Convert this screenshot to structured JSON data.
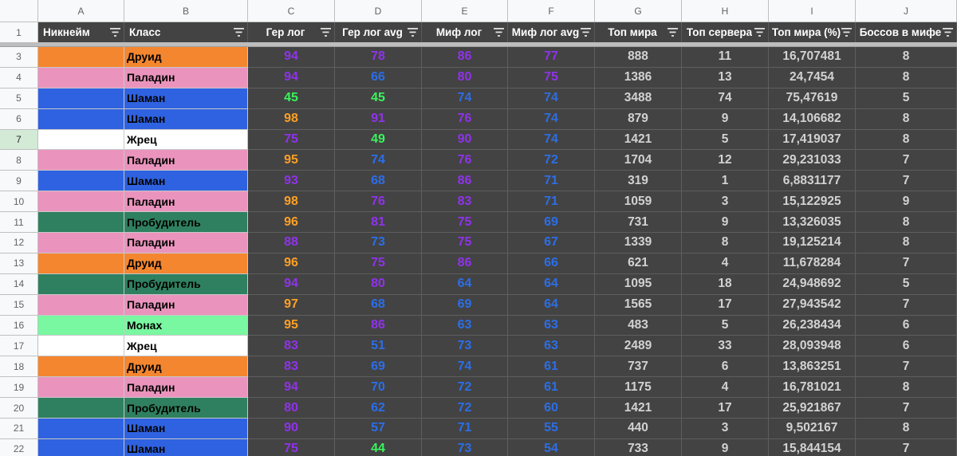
{
  "column_letters": [
    "A",
    "B",
    "C",
    "D",
    "E",
    "F",
    "G",
    "H",
    "I",
    "J"
  ],
  "headers": {
    "row_number": "1",
    "a": "Никнейм",
    "b": "Класс",
    "c": "Гер лог",
    "d": "Гер лог avg",
    "e": "Миф лог",
    "f": "Миф лог avg",
    "g": "Топ мира",
    "h": "Топ сервера",
    "i": "Топ мира (%)",
    "j": "Боссов в мифе"
  },
  "class_colors": {
    "Друид": "#f4862f",
    "Паладин": "#ea94bd",
    "Шаман": "#2f62e0",
    "Жрец": "#ffffff",
    "Пробудитель": "#2f8060",
    "Монах": "#79f7a1"
  },
  "value_colors": {
    "orange": "#ffa025",
    "purple": "#9032ec",
    "blue": "#2b6ee8",
    "green": "#39f45c"
  },
  "rows": [
    {
      "n": "3",
      "cls": "Друид",
      "c": "94",
      "cc": "purple",
      "d": "78",
      "dc": "purple",
      "e": "86",
      "ec": "purple",
      "f": "77",
      "fc": "purple",
      "g": "888",
      "h": "11",
      "i": "16,707481",
      "j": "8"
    },
    {
      "n": "4",
      "cls": "Паладин",
      "c": "94",
      "cc": "purple",
      "d": "66",
      "dc": "blue",
      "e": "80",
      "ec": "purple",
      "f": "75",
      "fc": "purple",
      "g": "1386",
      "h": "13",
      "i": "24,7454",
      "j": "8"
    },
    {
      "n": "5",
      "cls": "Шаман",
      "c": "45",
      "cc": "green",
      "d": "45",
      "dc": "green",
      "e": "74",
      "ec": "blue",
      "f": "74",
      "fc": "blue",
      "g": "3488",
      "h": "74",
      "i": "75,47619",
      "j": "5"
    },
    {
      "n": "6",
      "cls": "Шаман",
      "c": "98",
      "cc": "orange",
      "d": "91",
      "dc": "purple",
      "e": "76",
      "ec": "purple",
      "f": "74",
      "fc": "blue",
      "g": "879",
      "h": "9",
      "i": "14,106682",
      "j": "8"
    },
    {
      "n": "7",
      "cls": "Жрец",
      "c": "75",
      "cc": "purple",
      "d": "49",
      "dc": "green",
      "e": "90",
      "ec": "purple",
      "f": "74",
      "fc": "blue",
      "g": "1421",
      "h": "5",
      "i": "17,419037",
      "j": "8",
      "selected": true
    },
    {
      "n": "8",
      "cls": "Паладин",
      "c": "95",
      "cc": "orange",
      "d": "74",
      "dc": "blue",
      "e": "76",
      "ec": "purple",
      "f": "72",
      "fc": "blue",
      "g": "1704",
      "h": "12",
      "i": "29,231033",
      "j": "7"
    },
    {
      "n": "9",
      "cls": "Шаман",
      "c": "93",
      "cc": "purple",
      "d": "68",
      "dc": "blue",
      "e": "86",
      "ec": "purple",
      "f": "71",
      "fc": "blue",
      "g": "319",
      "h": "1",
      "i": "6,8831177",
      "j": "7"
    },
    {
      "n": "10",
      "cls": "Паладин",
      "c": "98",
      "cc": "orange",
      "d": "76",
      "dc": "purple",
      "e": "83",
      "ec": "purple",
      "f": "71",
      "fc": "blue",
      "g": "1059",
      "h": "3",
      "i": "15,122925",
      "j": "9"
    },
    {
      "n": "11",
      "cls": "Пробудитель",
      "c": "96",
      "cc": "orange",
      "d": "81",
      "dc": "purple",
      "e": "75",
      "ec": "purple",
      "f": "69",
      "fc": "blue",
      "g": "731",
      "h": "9",
      "i": "13,326035",
      "j": "8"
    },
    {
      "n": "12",
      "cls": "Паладин",
      "c": "88",
      "cc": "purple",
      "d": "73",
      "dc": "blue",
      "e": "75",
      "ec": "purple",
      "f": "67",
      "fc": "blue",
      "g": "1339",
      "h": "8",
      "i": "19,125214",
      "j": "8"
    },
    {
      "n": "13",
      "cls": "Друид",
      "c": "96",
      "cc": "orange",
      "d": "75",
      "dc": "purple",
      "e": "86",
      "ec": "purple",
      "f": "66",
      "fc": "blue",
      "g": "621",
      "h": "4",
      "i": "11,678284",
      "j": "7"
    },
    {
      "n": "14",
      "cls": "Пробудитель",
      "c": "94",
      "cc": "purple",
      "d": "80",
      "dc": "purple",
      "e": "64",
      "ec": "blue",
      "f": "64",
      "fc": "blue",
      "g": "1095",
      "h": "18",
      "i": "24,948692",
      "j": "5"
    },
    {
      "n": "15",
      "cls": "Паладин",
      "c": "97",
      "cc": "orange",
      "d": "68",
      "dc": "blue",
      "e": "69",
      "ec": "blue",
      "f": "64",
      "fc": "blue",
      "g": "1565",
      "h": "17",
      "i": "27,943542",
      "j": "7"
    },
    {
      "n": "16",
      "cls": "Монах",
      "c": "95",
      "cc": "orange",
      "d": "86",
      "dc": "purple",
      "e": "63",
      "ec": "blue",
      "f": "63",
      "fc": "blue",
      "g": "483",
      "h": "5",
      "i": "26,238434",
      "j": "6"
    },
    {
      "n": "17",
      "cls": "Жрец",
      "c": "83",
      "cc": "purple",
      "d": "51",
      "dc": "blue",
      "e": "73",
      "ec": "blue",
      "f": "63",
      "fc": "blue",
      "g": "2489",
      "h": "33",
      "i": "28,093948",
      "j": "6"
    },
    {
      "n": "18",
      "cls": "Друид",
      "c": "83",
      "cc": "purple",
      "d": "69",
      "dc": "blue",
      "e": "74",
      "ec": "blue",
      "f": "61",
      "fc": "blue",
      "g": "737",
      "h": "6",
      "i": "13,863251",
      "j": "7"
    },
    {
      "n": "19",
      "cls": "Паладин",
      "c": "94",
      "cc": "purple",
      "d": "70",
      "dc": "blue",
      "e": "72",
      "ec": "blue",
      "f": "61",
      "fc": "blue",
      "g": "1175",
      "h": "4",
      "i": "16,781021",
      "j": "8"
    },
    {
      "n": "20",
      "cls": "Пробудитель",
      "c": "80",
      "cc": "purple",
      "d": "62",
      "dc": "blue",
      "e": "72",
      "ec": "blue",
      "f": "60",
      "fc": "blue",
      "g": "1421",
      "h": "17",
      "i": "25,921867",
      "j": "7"
    },
    {
      "n": "21",
      "cls": "Шаман",
      "c": "90",
      "cc": "purple",
      "d": "57",
      "dc": "blue",
      "e": "71",
      "ec": "blue",
      "f": "55",
      "fc": "blue",
      "g": "440",
      "h": "3",
      "i": "9,502167",
      "j": "8"
    },
    {
      "n": "22",
      "cls": "Шаман",
      "c": "75",
      "cc": "purple",
      "d": "44",
      "dc": "green",
      "e": "73",
      "ec": "blue",
      "f": "54",
      "fc": "blue",
      "g": "733",
      "h": "9",
      "i": "15,844154",
      "j": "7"
    }
  ]
}
